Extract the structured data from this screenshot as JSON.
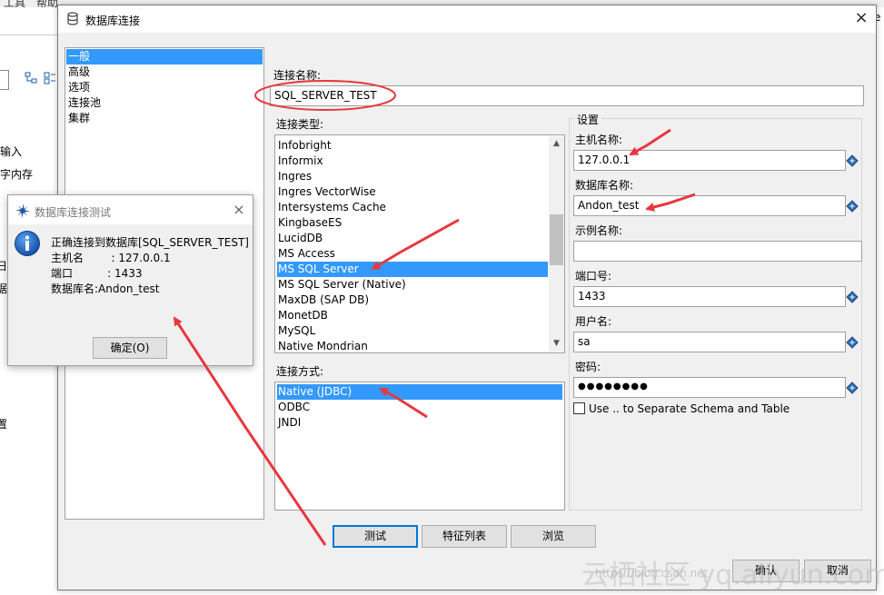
{
  "background_app": {
    "menu_items": [
      "工具",
      "帮助"
    ],
    "side_texts": [
      "输入",
      "字内存",
      "日",
      "据",
      "置"
    ],
    "right_text": "e"
  },
  "dialog": {
    "title": "数据库连接",
    "close_glyph": "×",
    "nav_items": [
      {
        "label": "一般",
        "selected": true
      },
      {
        "label": "高级",
        "selected": false
      },
      {
        "label": "选项",
        "selected": false
      },
      {
        "label": "连接池",
        "selected": false
      },
      {
        "label": "集群",
        "selected": false
      }
    ],
    "connection_name_label": "连接名称:",
    "connection_name_value": "SQL_SERVER_TEST",
    "connection_type_label": "连接类型:",
    "connection_types": [
      {
        "label": "Infobright",
        "selected": false
      },
      {
        "label": "Informix",
        "selected": false
      },
      {
        "label": "Ingres",
        "selected": false
      },
      {
        "label": "Ingres VectorWise",
        "selected": false
      },
      {
        "label": "Intersystems Cache",
        "selected": false
      },
      {
        "label": "KingbaseES",
        "selected": false
      },
      {
        "label": "LucidDB",
        "selected": false
      },
      {
        "label": "MS Access",
        "selected": false
      },
      {
        "label": "MS SQL Server",
        "selected": true
      },
      {
        "label": "MS SQL Server (Native)",
        "selected": false
      },
      {
        "label": "MaxDB (SAP DB)",
        "selected": false
      },
      {
        "label": "MonetDB",
        "selected": false
      },
      {
        "label": "MySQL",
        "selected": false
      },
      {
        "label": "Native Mondrian",
        "selected": false
      }
    ],
    "access_method_label": "连接方式:",
    "access_methods": [
      {
        "label": "Native (JDBC)",
        "selected": true
      },
      {
        "label": "ODBC",
        "selected": false
      },
      {
        "label": "JNDI",
        "selected": false
      }
    ],
    "settings": {
      "group_title": "设置",
      "host_label": "主机名称:",
      "host_value": "127.0.0.1",
      "db_label": "数据库名称:",
      "db_value": "Andon_test",
      "instance_label": "示例名称:",
      "instance_value": "",
      "port_label": "端口号:",
      "port_value": "1433",
      "user_label": "用户名:",
      "user_value": "sa",
      "password_label": "密码:",
      "password_value": "●●●●●●●●",
      "schema_checkbox_label": "Use .. to Separate Schema and Table",
      "schema_checkbox_checked": false
    },
    "buttons": {
      "test": "测试",
      "features": "特征列表",
      "browse": "浏览",
      "ok": "确认",
      "cancel": "取消"
    }
  },
  "test_dialog": {
    "title": "数据库连接测试",
    "close_glyph": "×",
    "message_lines": [
      "正确连接到数据库[SQL_SERVER_TEST]",
      "主机名        : 127.0.0.1",
      "端口          : 1433",
      "数据库名:Andon_test"
    ],
    "ok_button": "确定(O)"
  },
  "watermark": {
    "text": "云栖社区 yq.aliyun.com",
    "small_text": "https://blog.csdn.net"
  },
  "colors": {
    "selection": "#3399ff",
    "annotation": "#e8383d",
    "dialog_bg": "#f0f0f0",
    "info_blue": "#1c6fd1"
  }
}
